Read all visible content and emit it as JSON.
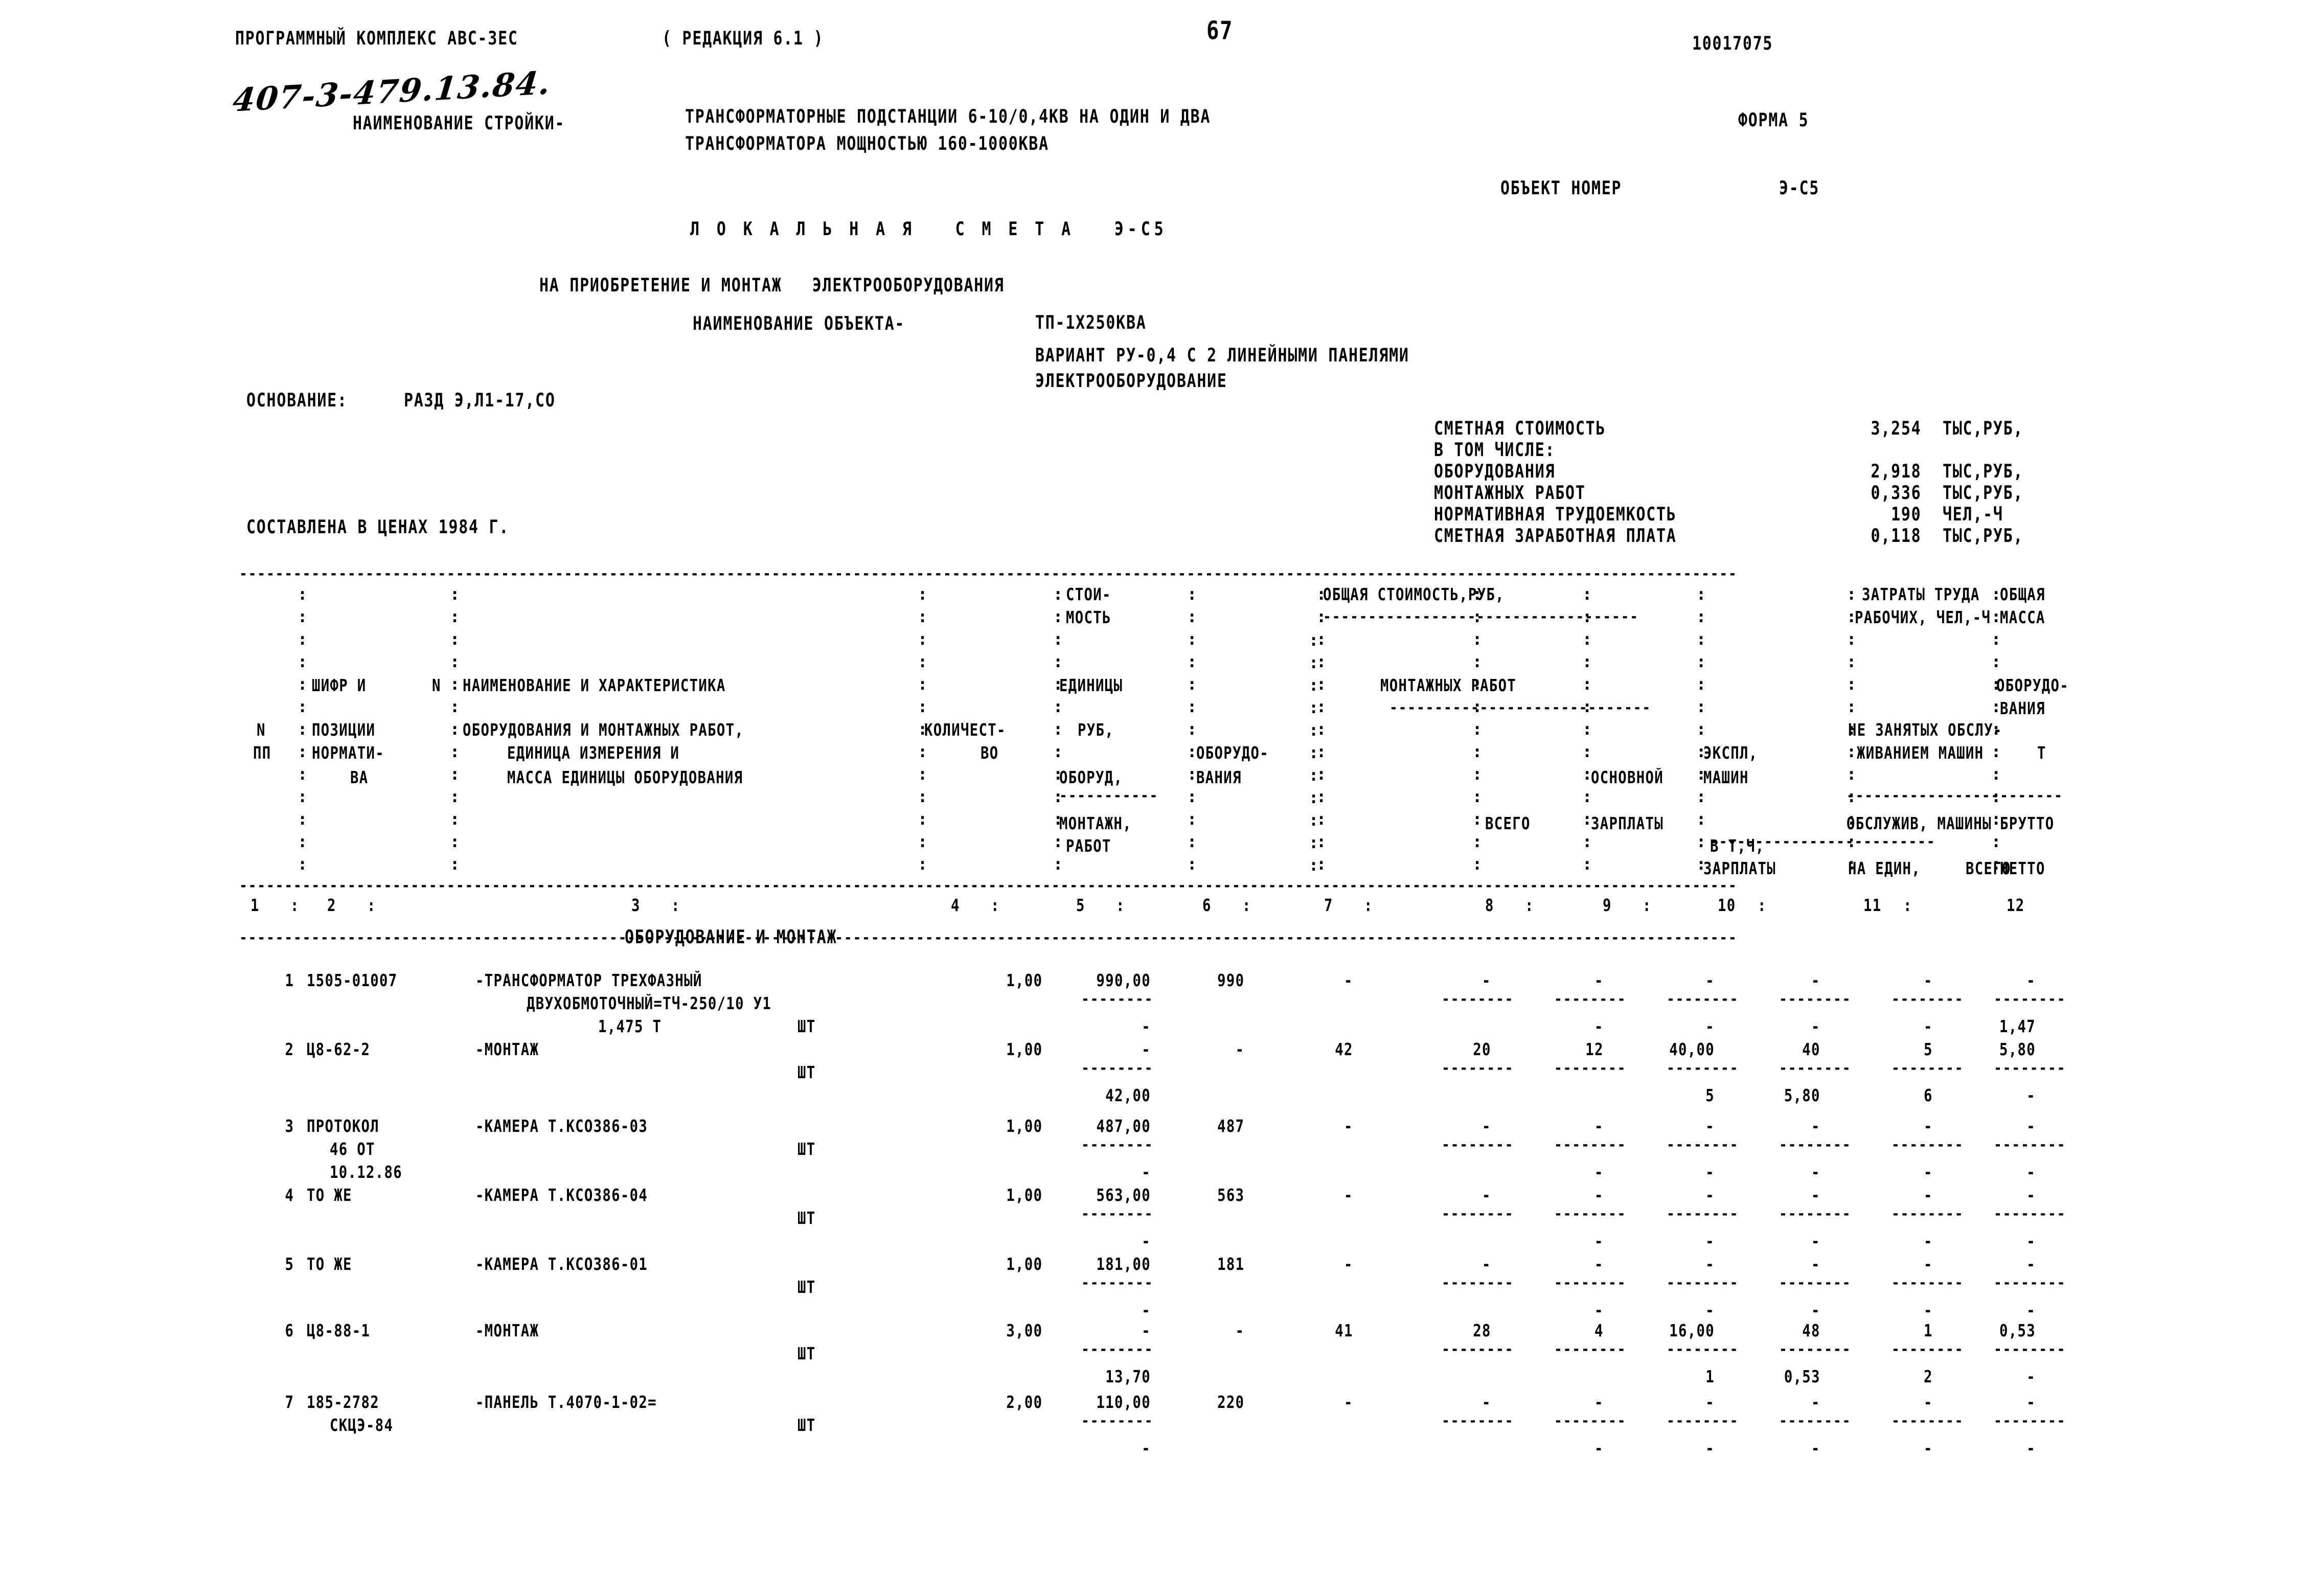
{
  "header": {
    "program_title": "ПРОГРАММНЫЙ КОМПЛЕКС АВС-3ЕС",
    "revision": "( РЕДАКЦИЯ 6.1 )",
    "page_number": "67",
    "doc_code": "10017075",
    "form_label": "ФОРМА 5",
    "handwritten_note": "407-3-479.13.84.",
    "site_name_label": "НАИМЕНОВАНИЕ СТРОЙКИ-",
    "site_name_line1": "ТРАНСФОРМАТОРНЫЕ ПОДСТАНЦИИ 6-10/0,4КВ НА ОДИН И ДВА",
    "site_name_line2": "ТРАНСФОРМАТОРА МОЩНОСТЬЮ 160-1000КВА",
    "object_number_label": "ОБЪЕКТ НОМЕР",
    "object_number_value": "Э-С5"
  },
  "titles": {
    "estimate_title": "Л О К А Л Ь Н А Я   С М Е Т А   Э-С5",
    "purpose": "НА ПРИОБРЕТЕНИЕ И МОНТАЖ   ЭЛЕКТРООБОРУДОВАНИЯ",
    "object_label": "НАИМЕНОВАНИЕ ОБЪЕКТА-",
    "object_value": "ТП-1Х250КВА",
    "variant_line1": "ВАРИАНТ РУ-0,4 С 2 ЛИНЕЙНЫМИ ПАНЕЛЯМИ",
    "variant_line2": "ЭЛЕКТРООБОРУДОВАНИЕ",
    "basis_label": "ОСНОВАНИЕ:",
    "basis_value": "РАЗД Э,Л1-17,СО",
    "prices_note": "СОСТАВЛЕНА В ЦЕНАХ 1984 Г."
  },
  "summary": [
    {
      "label": "СМЕТНАЯ СТОИМОСТЬ",
      "value": "3,254",
      "unit": "ТЫС,РУБ,"
    },
    {
      "label": "В ТОМ ЧИСЛЕ:",
      "value": "",
      "unit": ""
    },
    {
      "label": "ОБОРУДОВАНИЯ",
      "value": "2,918",
      "unit": "ТЫС,РУБ,"
    },
    {
      "label": "МОНТАЖНЫХ РАБОТ",
      "value": "0,336",
      "unit": "ТЫС,РУБ,"
    },
    {
      "label": "НОРМАТИВНАЯ ТРУДОЕМКОСТЬ",
      "value": "190",
      "unit": "ЧЕЛ,-Ч"
    },
    {
      "label": "СМЕТНАЯ ЗАРАБОТНАЯ ПЛАТА",
      "value": "0,118",
      "unit": "ТЫС,РУБ,"
    }
  ],
  "table_header": {
    "col1_l1": "N",
    "col1_l2": "ПП",
    "col2_l1": "ШИФР И",
    "col2_l1b": "N",
    "col2_l2": "ПОЗИЦИИ",
    "col2_l3": "НОРМАТИ-",
    "col2_l4": "ВА",
    "col3_l1": "НАИМЕНОВАНИЕ И ХАРАКТЕРИСТИКА",
    "col3_l2": "ОБОРУДОВАНИЯ И МОНТАЖНЫХ РАБОТ,",
    "col3_l3": "ЕДИНИЦА ИЗМЕРЕНИЯ И",
    "col3_l4": "МАССА ЕДИНИЦЫ ОБОРУДОВАНИЯ",
    "col4_l1": "КОЛИЧЕСТ-",
    "col4_l2": "ВО",
    "col5_l1": "СТОИ-",
    "col5_l2": "МОСТЬ",
    "col5_l3": "ЕДИНИЦЫ",
    "col5_l4": "РУБ,",
    "col5_l5": "ОБОРУД,",
    "col5_l6": "МОНТАЖН,",
    "col5_l7": "РАБОТ",
    "col6_l1": "ОБОРУДО-",
    "col6_l2": "ВАНИЯ",
    "grp_total": "ОБЩАЯ СТОИМОСТЬ,РУБ,",
    "grp_install": "МОНТАЖНЫХ РАБОТ",
    "col7": "ВСЕГО",
    "col8_l1": "ОСНОВНОЙ",
    "col8_l2": "ЗАРПЛАТЫ",
    "col9_l1": "ЭКСПЛ,",
    "col9_l2": "МАШИН",
    "col9_l3": "В Т,Ч,",
    "col9_l4": "ЗАРПЛАТЫ",
    "grp_labor_l1": "ЗАТРАТЫ ТРУДА",
    "grp_labor_l2": "РАБОЧИХ, ЧЕЛ,-Ч",
    "grp_labor_l3": "НЕ ЗАНЯТЫХ ОБСЛУ-",
    "grp_labor_l4": "ЖИВАНИЕМ МАШИН",
    "grp_labor_l5": "ОБСЛУЖИВ, МАШИНЫ",
    "col10": "НА ЕДИН,",
    "col11": "ВСЕГО",
    "col12_l1": "ОБЩАЯ",
    "col12_l2": "МАССА",
    "col12_l3": "ОБОРУДО-",
    "col12_l4": "ВАНИЯ",
    "col12_l5": "Т",
    "col12_l6": "БРУТТО",
    "col12_l7": "НЕТТО",
    "numbers": [
      "1",
      "2",
      "3",
      "4",
      "5",
      "6",
      "7",
      "8",
      "9",
      "10",
      "11",
      "12"
    ]
  },
  "section_title": "ОБОРУДОВАНИЕ И МОНТАЖ",
  "rows": [
    {
      "num": "1",
      "code": "1505-01007",
      "name1": "-ТРАНСФОРМАТОР ТРЕХФАЗНЫЙ",
      "name2": "ДВУХОБМОТОЧНЫЙ=ТЧ-250/10 У1",
      "name3": "1,475 Т",
      "unit": "ШТ",
      "qty": "1,00",
      "price_equip": "990,00",
      "price_install": "-",
      "total_equip": "990",
      "total_all": "-",
      "total_basic": "-",
      "total_mach": "-",
      "labor_unit": "-",
      "labor_total": "-",
      "mach_unit": "-",
      "mach_total": "-",
      "mass_brutto": "-",
      "mass_netto": "1,47"
    },
    {
      "num": "2",
      "code": "Ц8-62-2",
      "name1": "-МОНТАЖ",
      "name2": "",
      "name3": "",
      "unit": "ШТ",
      "qty": "1,00",
      "price_equip": "-",
      "price_install": "42,00",
      "total_equip": "-",
      "total_all": "42",
      "total_basic": "20",
      "total_mach": "12",
      "labor_unit": "40,00",
      "labor_total": "40",
      "mach_unit": "5",
      "mach_total": "5,80",
      "mass_brutto": "6",
      "mass_netto": "-"
    },
    {
      "num": "3",
      "code": "ПРОТОКОЛ",
      "code2": "46 ОТ",
      "code3": "10.12.86",
      "name1": "-КАМЕРА Т.КСО386-03",
      "name2": "",
      "name3": "",
      "unit": "ШТ",
      "qty": "1,00",
      "price_equip": "487,00",
      "price_install": "-",
      "total_equip": "487",
      "total_all": "-",
      "total_basic": "-",
      "total_mach": "-",
      "labor_unit": "-",
      "labor_total": "-",
      "mach_unit": "-",
      "mach_total": "-",
      "mass_brutto": "-",
      "mass_netto": "-"
    },
    {
      "num": "4",
      "code": "ТО ЖЕ",
      "name1": "-КАМЕРА Т.КСО386-04",
      "name2": "",
      "name3": "",
      "unit": "ШТ",
      "qty": "1,00",
      "price_equip": "563,00",
      "price_install": "-",
      "total_equip": "563",
      "total_all": "-",
      "total_basic": "-",
      "total_mach": "-",
      "labor_unit": "-",
      "labor_total": "-",
      "mach_unit": "-",
      "mach_total": "-",
      "mass_brutto": "-",
      "mass_netto": "-"
    },
    {
      "num": "5",
      "code": "ТО ЖЕ",
      "name1": "-КАМЕРА Т.КСО386-01",
      "name2": "",
      "name3": "",
      "unit": "ШТ",
      "qty": "1,00",
      "price_equip": "181,00",
      "price_install": "-",
      "total_equip": "181",
      "total_all": "-",
      "total_basic": "-",
      "total_mach": "-",
      "labor_unit": "-",
      "labor_total": "-",
      "mach_unit": "-",
      "mach_total": "-",
      "mass_brutto": "-",
      "mass_netto": "-"
    },
    {
      "num": "6",
      "code": "Ц8-88-1",
      "name1": "-МОНТАЖ",
      "name2": "",
      "name3": "",
      "unit": "ШТ",
      "qty": "3,00",
      "price_equip": "-",
      "price_install": "13,70",
      "total_equip": "-",
      "total_all": "41",
      "total_basic": "28",
      "total_mach": "4",
      "labor_unit": "16,00",
      "labor_total": "48",
      "mach_unit": "1",
      "mach_total": "0,53",
      "mass_brutto": "2",
      "mass_netto": "-"
    },
    {
      "num": "7",
      "code": "185-2782",
      "code2": "СКЦЭ-84",
      "name1": "-ПАНЕЛЬ Т.4070-1-02=",
      "name2": "",
      "name3": "",
      "unit": "ШТ",
      "qty": "2,00",
      "price_equip": "110,00",
      "price_install": "-",
      "total_equip": "220",
      "total_all": "-",
      "total_basic": "-",
      "total_mach": "-",
      "labor_unit": "-",
      "labor_total": "-",
      "mach_unit": "-",
      "mach_total": "-",
      "mass_brutto": "-",
      "mass_netto": "-"
    }
  ]
}
